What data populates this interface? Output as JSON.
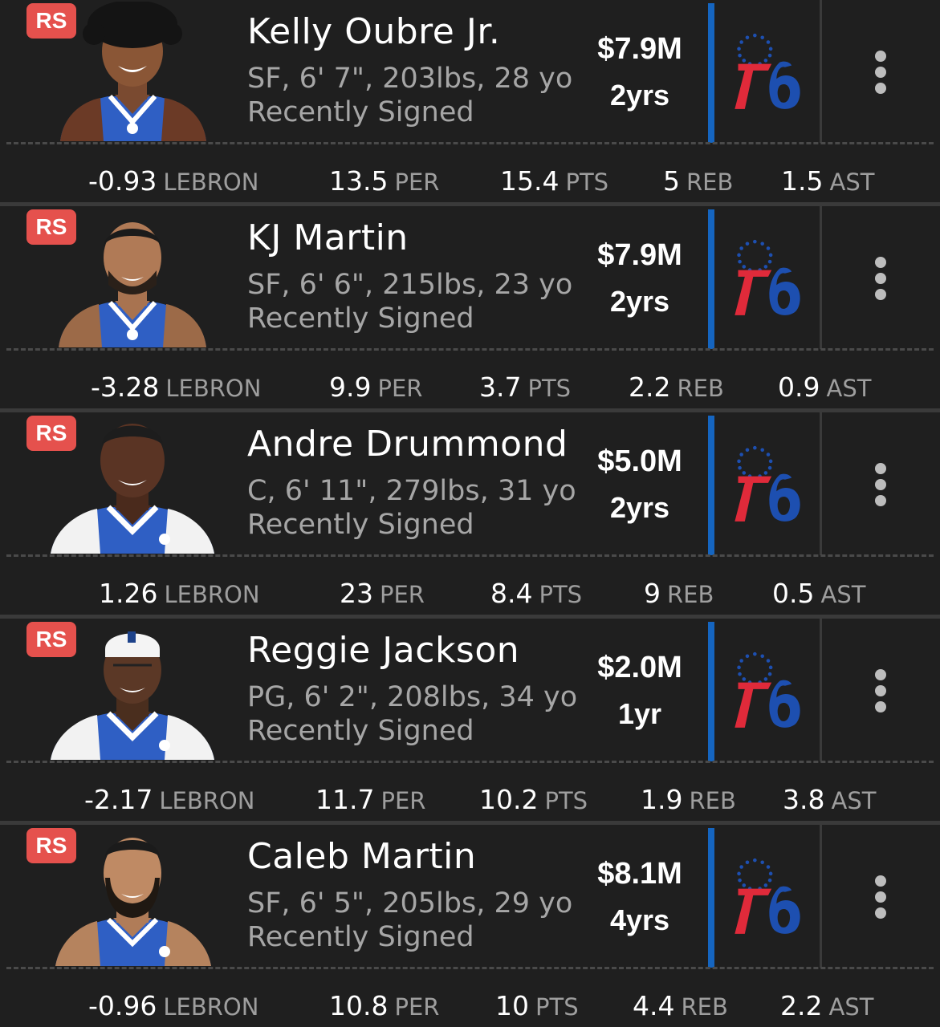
{
  "badge_label": "RS",
  "team": "76ers",
  "colors": {
    "card_bg": "#1f1f1f",
    "badge": "#e5514d",
    "team_bar": "#1565c0",
    "logo_red": "#e02a3a",
    "logo_blue": "#1d4fb0"
  },
  "icons": {
    "menu": "more-vert-icon",
    "team_logo": "sixers-logo-icon"
  },
  "players": [
    {
      "name": "Kelly Oubre Jr.",
      "info": "SF, 6' 7\", 203lbs, 28 yo",
      "status": "Recently Signed",
      "salary": "$7.9M",
      "years": "2yrs",
      "stats": [
        {
          "value": "-0.93",
          "label": "LEBRON"
        },
        {
          "value": "13.5",
          "label": "PER"
        },
        {
          "value": "15.4",
          "label": "PTS"
        },
        {
          "value": "5",
          "label": "REB"
        },
        {
          "value": "1.5",
          "label": "AST"
        }
      ]
    },
    {
      "name": "KJ Martin",
      "info": "SF, 6' 6\", 215lbs, 23 yo",
      "status": "Recently Signed",
      "salary": "$7.9M",
      "years": "2yrs",
      "stats": [
        {
          "value": "-3.28",
          "label": "LEBRON"
        },
        {
          "value": "9.9",
          "label": "PER"
        },
        {
          "value": "3.7",
          "label": "PTS"
        },
        {
          "value": "2.2",
          "label": "REB"
        },
        {
          "value": "0.9",
          "label": "AST"
        }
      ]
    },
    {
      "name": "Andre Drummond",
      "info": "C, 6' 11\", 279lbs, 31 yo",
      "status": "Recently Signed",
      "salary": "$5.0M",
      "years": "2yrs",
      "stats": [
        {
          "value": "1.26",
          "label": "LEBRON"
        },
        {
          "value": "23",
          "label": "PER"
        },
        {
          "value": "8.4",
          "label": "PTS"
        },
        {
          "value": "9",
          "label": "REB"
        },
        {
          "value": "0.5",
          "label": "AST"
        }
      ]
    },
    {
      "name": "Reggie Jackson",
      "info": "PG, 6' 2\", 208lbs, 34 yo",
      "status": "Recently Signed",
      "salary": "$2.0M",
      "years": "1yr",
      "stats": [
        {
          "value": "-2.17",
          "label": "LEBRON"
        },
        {
          "value": "11.7",
          "label": "PER"
        },
        {
          "value": "10.2",
          "label": "PTS"
        },
        {
          "value": "1.9",
          "label": "REB"
        },
        {
          "value": "3.8",
          "label": "AST"
        }
      ]
    },
    {
      "name": "Caleb Martin",
      "info": "SF, 6' 5\", 205lbs, 29 yo",
      "status": "Recently Signed",
      "salary": "$8.1M",
      "years": "4yrs",
      "stats": [
        {
          "value": "-0.96",
          "label": "LEBRON"
        },
        {
          "value": "10.8",
          "label": "PER"
        },
        {
          "value": "10",
          "label": "PTS"
        },
        {
          "value": "4.4",
          "label": "REB"
        },
        {
          "value": "2.2",
          "label": "AST"
        }
      ]
    }
  ]
}
